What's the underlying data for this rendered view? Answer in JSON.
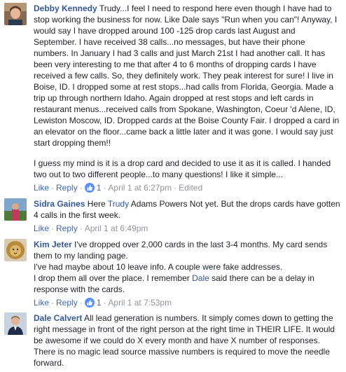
{
  "comments": [
    {
      "author": "Debby Kennedy",
      "p1": "Trudy...I feel I need to respond here even though I have had to stop working the business for now. Like Dale says \"Run when you can\"! Anyway, I would say I have dropped around 100 -125 drop cards last August and September. I have received 38 calls...no messages, but have their phone numbers. In January I had 3 calls and just March 21st I had another call. It has been very interesting to me that after 4 to 6 months of dropping cards I have received a few calls. So, they definitely work. They peak interest for sure! I live in Boise, ID. I dropped some at rest stops...had calls from Florida, Georgia. Made a trip up through northern Idaho. Again dropped at rest stops and left cards in restaurant menus...received calls from Spokane, Washington, Coeur 'd Alene, ID, Lewiston Moscow, ID. Dropped cards at the Boise County Fair. I dropped a card in an elevator on the floor...came back a little later and it was gone. I would say just start dropping them!!",
      "p2": "I guess my mind is it is a drop card and decided to use it as it is called. I handed two out to two different people...to many questions! I like it simple...",
      "like": "Like",
      "reply": "Reply",
      "reaction_count": "1",
      "timestamp": "April 1 at 6:27pm",
      "edited": "Edited"
    },
    {
      "author": "Sidra Gaines",
      "before": "Here ",
      "mention": "Trudy",
      "after": " Adams Powers Not yet. But the drops cards have gotten 4 calls in the first week.",
      "like": "Like",
      "reply": "Reply",
      "timestamp": "April 1 at 6:49pm"
    },
    {
      "author": "Kim Jeter",
      "line1": "I've dropped over 2,000 cards in the last 3-4 months. My card sends them to my landing page.",
      "line2": "I've had maybe about 10 leave info. A couple were fake addresses.",
      "line3_before": "I drop them all over the place. I remember ",
      "line3_mention": "Dale",
      "line3_after": " said there can be a delay in response with the cards.",
      "like": "Like",
      "reply": "Reply",
      "reaction_count": "1",
      "timestamp": "April 1 at 7:53pm"
    },
    {
      "author": "Dale Calvert",
      "text": "All lead generation is numbers. It simply comes down to getting the right message in front of the right person at the right time in THEIR LIFE. It would be awesome if we could do X every month and have X number of responses. There is no magic lead source massive numbers is required to move the needle forward."
    }
  ],
  "colors": {
    "link": "#365899",
    "action": "#4267b2",
    "meta": "#90949c",
    "like_badge": "#5890ff"
  },
  "icons": [
    "avatar-photo",
    "like-thumb-icon"
  ]
}
